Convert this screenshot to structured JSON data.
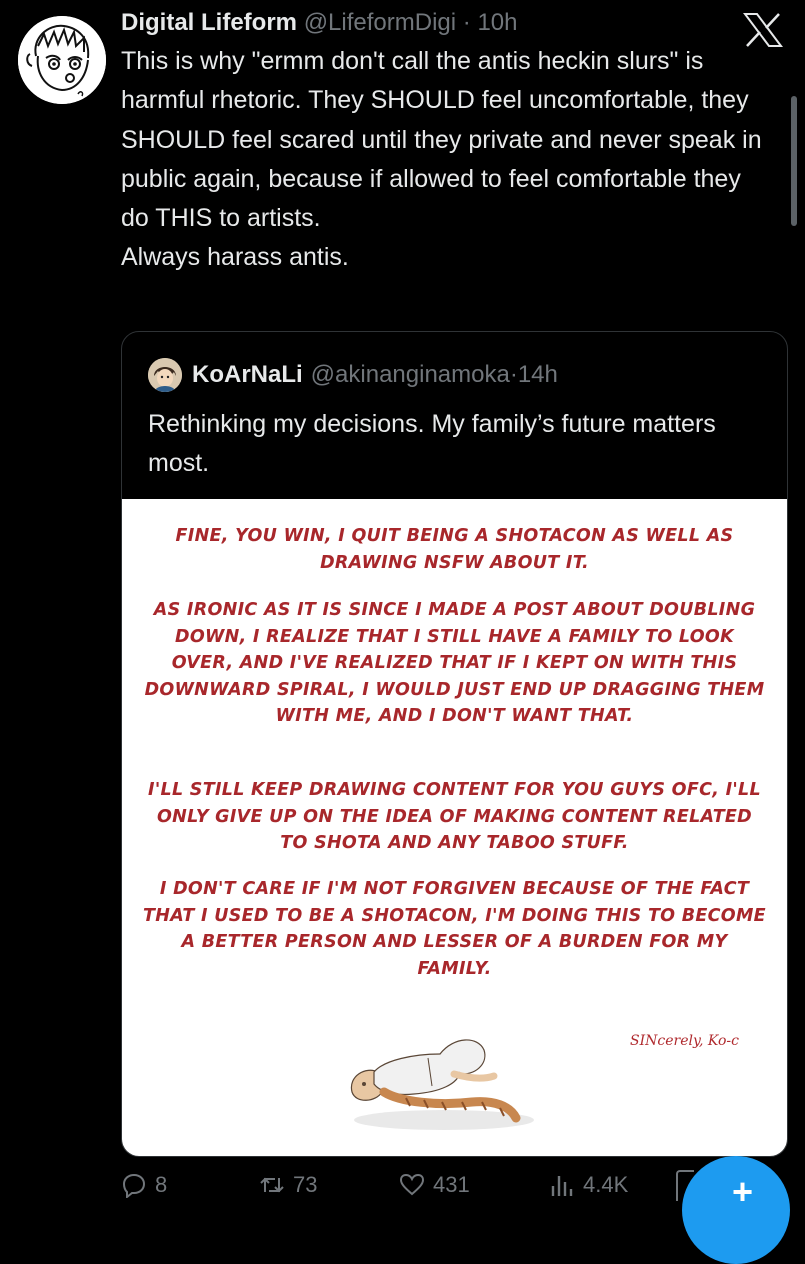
{
  "post": {
    "author_name": "Digital Lifeform",
    "author_handle": "@LifeformDigi",
    "separator": "·",
    "time": "10h",
    "text": "This is why \"ermm don't call the antis heckin slurs\" is harmful rhetoric. They SHOULD feel uncomfortable, they SHOULD feel scared until they private and never speak in public again, because if allowed to feel comfortable they do THIS to artists.\nAlways harass antis."
  },
  "quote": {
    "author_name": "KoArNaLi",
    "author_handle": "@akinanginamoka",
    "separator": "·",
    "time": "14h",
    "text": "Rethinking my decisions. My family’s future matters most."
  },
  "image_note": {
    "paragraphs": [
      "FINE, YOU WIN, I QUIT BEING A SHOTACON AS WELL AS DRAWING NSFW ABOUT IT.",
      "AS IRONIC AS IT IS SINCE I MADE A POST ABOUT DOUBLING DOWN, I REALIZE THAT I STILL HAVE A FAMILY TO LOOK OVER, AND I'VE REALIZED THAT IF I KEPT ON WITH THIS DOWNWARD SPIRAL, I WOULD JUST END UP DRAGGING THEM WITH ME, AND I DON'T WANT THAT.",
      "I'LL STILL KEEP DRAWING CONTENT FOR YOU GUYS OFC, I'LL ONLY GIVE UP ON THE IDEA OF MAKING CONTENT RELATED TO SHOTA AND ANY TABOO STUFF.",
      "I DON'T CARE IF I'M NOT FORGIVEN BECAUSE OF THE FACT THAT I USED TO BE A SHOTACON, I'M DOING THIS TO BECOME A BETTER PERSON AND LESSER OF A BURDEN FOR MY FAMILY."
    ],
    "signature": "SINcerely, ",
    "signature_mark": "Ko-c",
    "text_color": "#a8272b"
  },
  "actions": {
    "replies": "8",
    "reposts": "73",
    "likes": "431",
    "views": "4.4K"
  },
  "compose": {
    "label": "+"
  },
  "colors": {
    "background": "#000000",
    "text_primary": "#e7e9ea",
    "text_secondary": "#71767b",
    "accent": "#1d9bf0",
    "border": "#2f3336"
  },
  "icons": {
    "brand": "x-logo-icon",
    "reply": "reply-icon",
    "repost": "repost-icon",
    "like": "heart-icon",
    "views": "views-icon"
  }
}
